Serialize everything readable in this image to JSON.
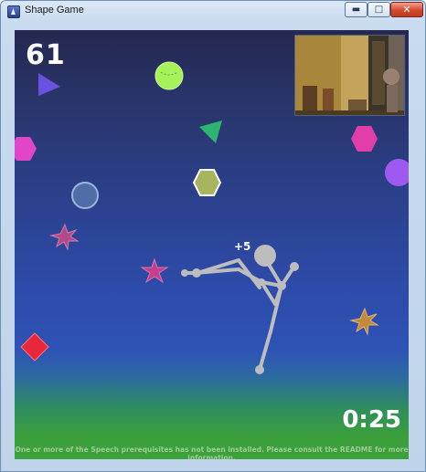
{
  "window": {
    "title": "Shape Game"
  },
  "controls": {
    "minimize": "▬",
    "maximize": "□",
    "close": "✕"
  },
  "hud": {
    "score": "61",
    "timer": "0:25",
    "points_popup": "+5",
    "message": "One or more of the Speech prerequisites has not been installed.  Please consult the README for more information."
  },
  "colors": {
    "sky_top": "#25274f",
    "sky_mid": "#2d4ba9",
    "ground": "#3ca33a",
    "player": "#bdbdbd"
  },
  "shapes": [
    {
      "name": "triangle-shape",
      "kind": "triangle",
      "color": "#6a52e0"
    },
    {
      "name": "circle-shape",
      "kind": "circle",
      "color": "#a6f25a"
    },
    {
      "name": "triangle-shape",
      "kind": "triangle",
      "color": "#2eb46e"
    },
    {
      "name": "hexagon-shape",
      "kind": "hexagon",
      "color": "#e246c8"
    },
    {
      "name": "hexagon-shape",
      "kind": "hexagon",
      "color": "#e23ea9"
    },
    {
      "name": "circle-shape",
      "kind": "circle",
      "color": "#9e5af0"
    },
    {
      "name": "hexagon-shape",
      "kind": "hexagon",
      "color": "#a7b560"
    },
    {
      "name": "circle-shape",
      "kind": "circle",
      "color": "#4f6ea8"
    },
    {
      "name": "star-shape",
      "kind": "star",
      "color": "#b04a8a"
    },
    {
      "name": "star-shape",
      "kind": "star",
      "color": "#c2408e"
    },
    {
      "name": "star-shape",
      "kind": "star",
      "color": "#c18a3a"
    },
    {
      "name": "square-shape",
      "kind": "square",
      "color": "#e8283a"
    }
  ]
}
